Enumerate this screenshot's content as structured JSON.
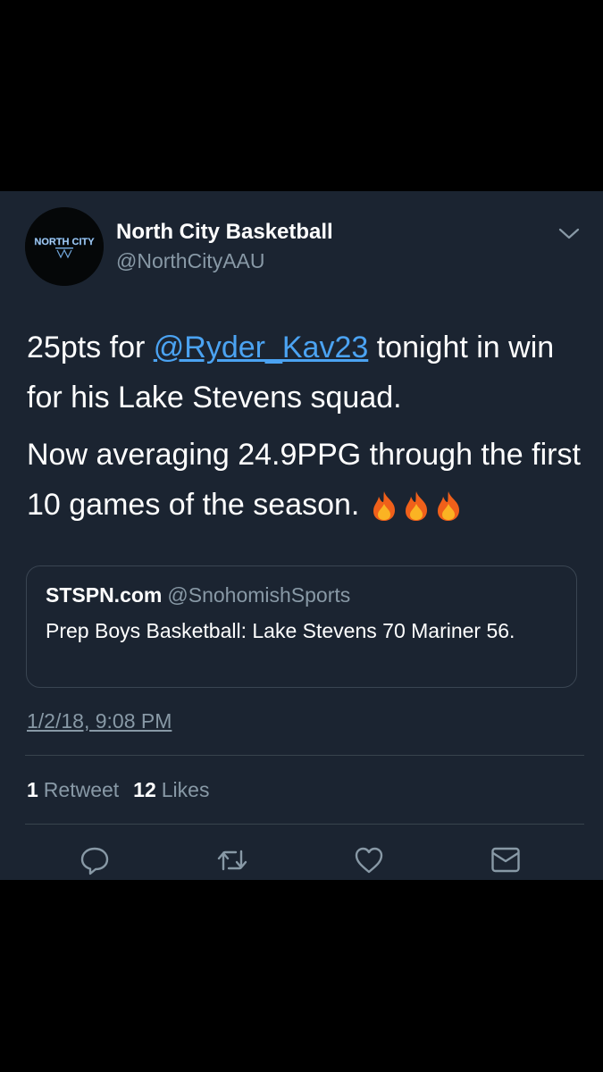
{
  "account": {
    "display_name": "North City Basketball",
    "handle": "@NorthCityAAU",
    "avatar_text": "NORTH CITY"
  },
  "tweet": {
    "line1_prefix": "25pts for ",
    "mention": "@Ryder_Kav23",
    "line1_suffix": " tonight in win for his Lake Stevens squad.",
    "line2": "Now averaging 24.9PPG through the first 10 games of the season.",
    "emoji": "fire-icon x3"
  },
  "quote": {
    "name": "STSPN.com",
    "handle": "@SnohomishSports",
    "text": "Prep Boys Basketball: Lake Stevens 70 Mariner 56."
  },
  "timestamp": "1/2/18, 9:08 PM",
  "stats": {
    "retweets_count": "1",
    "retweets_label": "Retweet",
    "likes_count": "12",
    "likes_label": "Likes"
  },
  "actions": {
    "icons": [
      "reply-icon",
      "retweet-icon",
      "like-icon",
      "direct-message-icon"
    ]
  },
  "colors": {
    "card_background": "#1b2431",
    "link": "#4ba3f2",
    "secondary_text": "#8899a6",
    "divider": "#38444d"
  }
}
